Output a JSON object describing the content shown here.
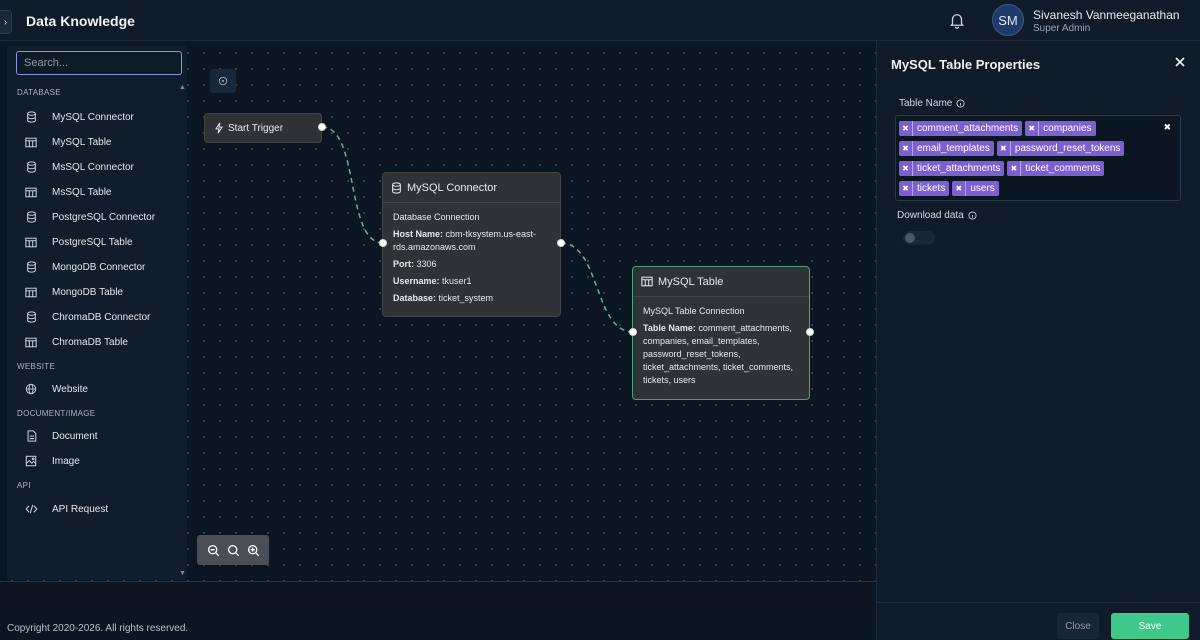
{
  "header": {
    "collapse_glyph": "›",
    "title": "Data Knowledge",
    "user_initials": "SM",
    "user_name": "Sivanesh Vanmeeganathan",
    "user_role": "Super Admin"
  },
  "palette": {
    "search_placeholder": "Search...",
    "sections": {
      "database": "DATABASE",
      "website": "WEBSITE",
      "document": "DOCUMENT/IMAGE",
      "api": "API"
    },
    "items": [
      {
        "label": "MySQL Connector",
        "icon": "database-icon"
      },
      {
        "label": "MySQL Table",
        "icon": "table-icon"
      },
      {
        "label": "MsSQL Connector",
        "icon": "database-icon"
      },
      {
        "label": "MsSQL Table",
        "icon": "table-icon"
      },
      {
        "label": "PostgreSQL Connector",
        "icon": "database-icon"
      },
      {
        "label": "PostgreSQL Table",
        "icon": "table-icon"
      },
      {
        "label": "MongoDB Connector",
        "icon": "database-icon"
      },
      {
        "label": "MongoDB Table",
        "icon": "table-icon"
      },
      {
        "label": "ChromaDB Connector",
        "icon": "database-icon"
      },
      {
        "label": "ChromaDB Table",
        "icon": "table-icon"
      },
      {
        "label": "Website",
        "icon": "globe-icon"
      },
      {
        "label": "Document",
        "icon": "document-icon"
      },
      {
        "label": "Image",
        "icon": "image-icon"
      },
      {
        "label": "API Request",
        "icon": "code-icon"
      }
    ]
  },
  "nodes": {
    "start": {
      "title": "Start Trigger"
    },
    "connector": {
      "title": "MySQL Connector",
      "subtitle": "Database Connection",
      "host_label": "Host Name:",
      "host_value": " cbm-tksystem.us-east-rds.amazonaws.com",
      "port_label": "Port:",
      "port_value": " 3306",
      "user_label": "Username:",
      "user_value": " tkuser1",
      "db_label": "Database:",
      "db_value": " ticket_system"
    },
    "table": {
      "title": "MySQL Table",
      "subtitle": "MySQL Table Connection",
      "tables_label": "Table Name:",
      "tables_value": " comment_attachments, companies, email_templates, password_reset_tokens, ticket_attachments, ticket_comments, tickets, users"
    }
  },
  "properties": {
    "title": "MySQL Table Properties",
    "table_name_label": "Table Name",
    "tags": [
      "comment_attachments",
      "companies",
      "email_templates",
      "password_reset_tokens",
      "ticket_attachments",
      "ticket_comments",
      "tickets",
      "users"
    ],
    "download_label": "Download data",
    "download_enabled": false,
    "close_label": "Close",
    "save_label": "Save"
  },
  "colors": {
    "accent_tag": "#7d5fd1",
    "save_button": "#3ec88a",
    "edge": "#5fb39a"
  },
  "footer": {
    "copyright": "Copyright 2020-2026. All rights reserved."
  }
}
